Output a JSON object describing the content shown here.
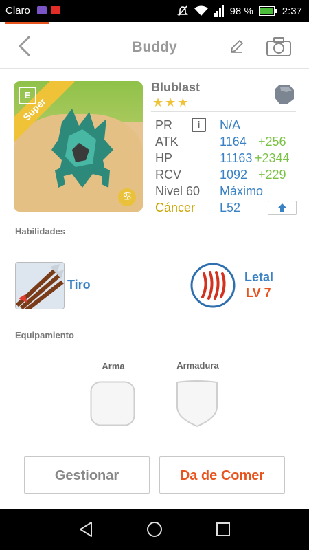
{
  "status_bar": {
    "carrier": "Claro",
    "battery": "98 %",
    "time": "2:37"
  },
  "header": {
    "title": "Buddy"
  },
  "monster": {
    "name": "Blublast",
    "stars": "★★★",
    "card_ribbon": "Super",
    "card_badge": "E",
    "zodiac_symbol": "♋",
    "stats": {
      "pr_label": "PR",
      "pr_info": "i",
      "pr_value": "N/A",
      "atk_label": "ATK",
      "atk_value": "1164",
      "atk_bonus": "+256",
      "hp_label": "HP",
      "hp_value": "11163",
      "hp_bonus": "+2344",
      "rcv_label": "RCV",
      "rcv_value": "1092",
      "rcv_bonus": "+229",
      "level_label": "Nivel 60",
      "level_value": "Máximo",
      "sign_label": "Cáncer",
      "sign_value": "L52"
    }
  },
  "skills": {
    "section_title": "Habilidades",
    "skill_name": "Tiro",
    "leader_name": "Letal",
    "leader_level": "LV 7"
  },
  "equipment": {
    "section_title": "Equipamiento",
    "weapon_label": "Arma",
    "armor_label": "Armadura"
  },
  "actions": {
    "manage_label": "Gestionar",
    "feed_label": "Da de Comer"
  },
  "colors": {
    "accent_orange": "#e8541e",
    "stat_blue": "#3b82c4",
    "bonus_green": "#7bc244",
    "star_gold": "#f0c237",
    "cancer_gold": "#c9a400"
  }
}
